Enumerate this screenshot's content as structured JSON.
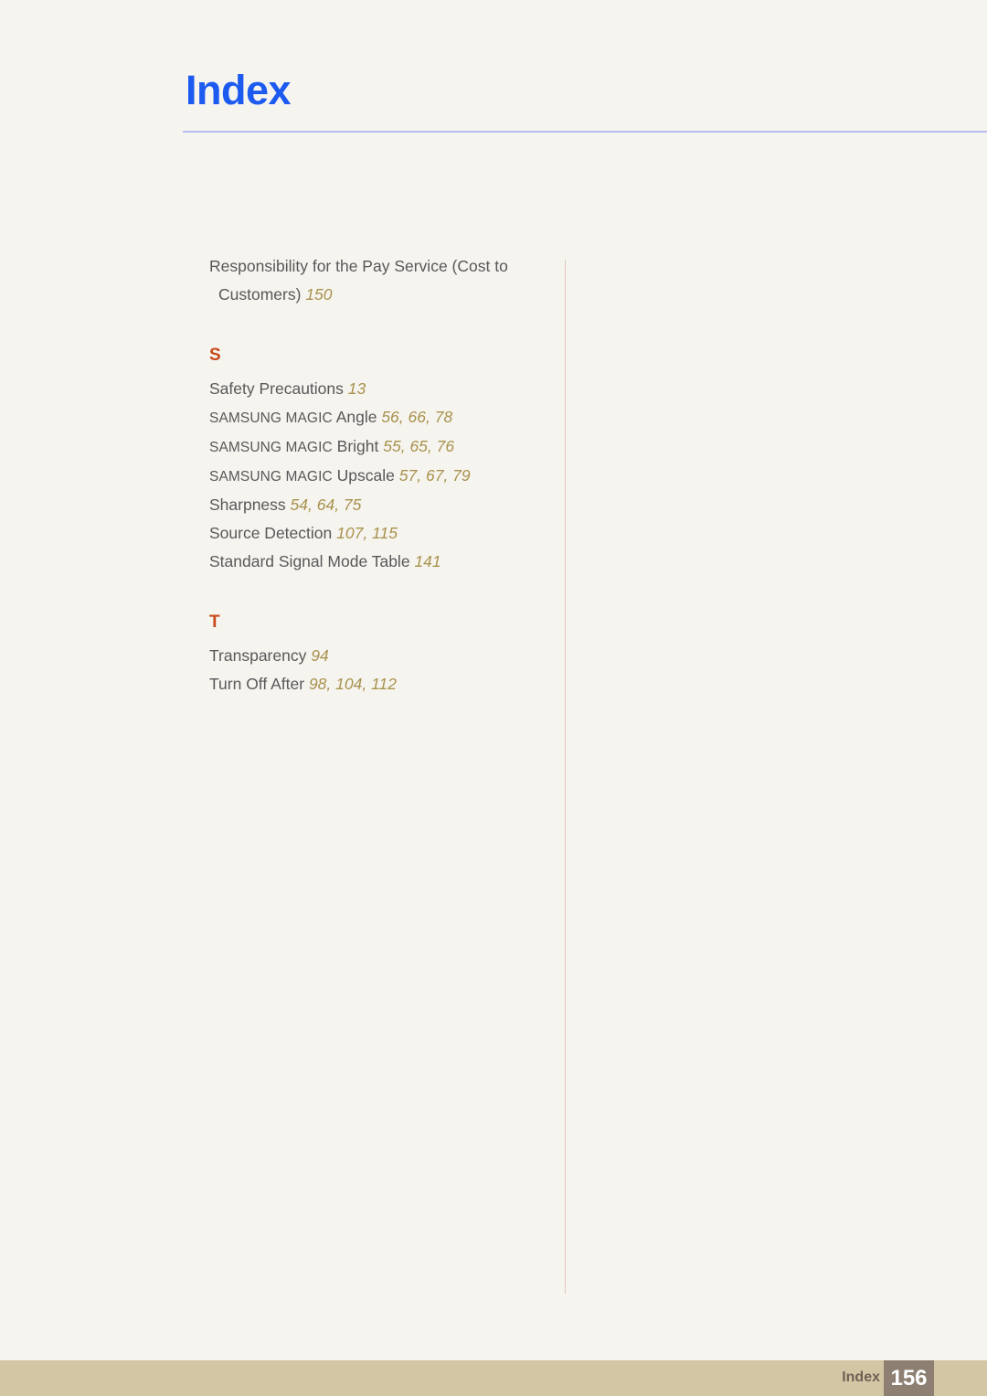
{
  "header": {
    "title": "Index"
  },
  "index": {
    "groups": [
      {
        "letter": "",
        "entries": [
          {
            "name": "Responsibility for the Pay Service (Cost to Customers)",
            "pages": "150"
          }
        ]
      },
      {
        "letter": "S",
        "entries": [
          {
            "name": "Safety Precautions",
            "pages": "13"
          },
          {
            "brand": "SAMSUNG MAGIC",
            "name": " Angle",
            "pages": "56, 66, 78"
          },
          {
            "brand": "SAMSUNG MAGIC",
            "name": " Bright",
            "pages": "55, 65, 76"
          },
          {
            "brand": "SAMSUNG MAGIC",
            "name": " Upscale",
            "pages": "57, 67, 79"
          },
          {
            "name": "Sharpness",
            "pages": "54, 64, 75"
          },
          {
            "name": "Source Detection",
            "pages": "107, 115"
          },
          {
            "name": "Standard Signal Mode Table",
            "pages": "141"
          }
        ]
      },
      {
        "letter": "T",
        "entries": [
          {
            "name": "Transparency",
            "pages": "94"
          },
          {
            "name": "Turn Off After",
            "pages": "98, 104, 112"
          }
        ]
      }
    ]
  },
  "footer": {
    "label": "Index",
    "page_number": "156"
  },
  "colors": {
    "page_background": "#f6f4ee",
    "title_blue": "#1d5bf0",
    "header_rule": "#b9bdf5",
    "entry_text": "#58585a",
    "page_ref_gold": "#a8924e",
    "section_letter_orange": "#c8491a",
    "column_rule": "#e3c9c2",
    "footer_band": "#d3c6a4",
    "footer_page_box": "#8d8073",
    "footer_label_text": "#6e6257",
    "footer_page_text": "#ffffff"
  }
}
